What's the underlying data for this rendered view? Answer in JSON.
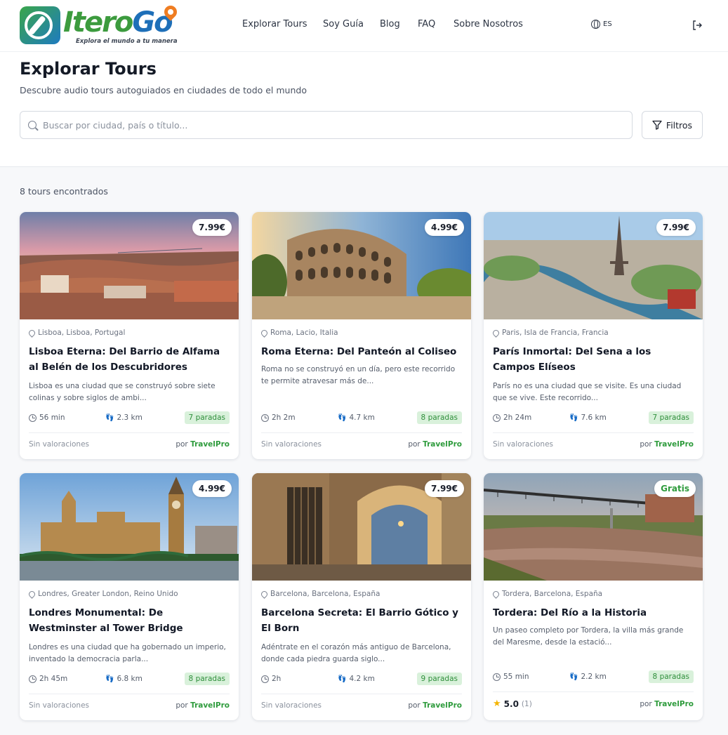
{
  "brand": {
    "name_part1": "Itero",
    "name_part2": "Go",
    "tagline": "Explora el mundo a tu manera",
    "colors": {
      "green": "#3c9b3e",
      "blue": "#1e6fb8",
      "orange": "#ef7d22"
    }
  },
  "nav": {
    "items": [
      {
        "label": "Explorar Tours"
      },
      {
        "label": "Soy Guía"
      },
      {
        "label": "Blog"
      },
      {
        "label": "FAQ"
      },
      {
        "label": "Sobre Nosotros"
      }
    ],
    "language": "ES",
    "icons": {
      "language": "globe-icon",
      "logout": "logout-icon"
    }
  },
  "page": {
    "title": "Explorar Tours",
    "subtitle": "Descubre audio tours autoguiados en ciudades de todo el mundo",
    "search_placeholder": "Buscar por ciudad, país o título...",
    "filters_label": "Filtros",
    "results_count": "8 tours encontrados"
  },
  "tours": [
    {
      "price": "7.99€",
      "location": "Lisboa, Lisboa, Portugal",
      "title": "Lisboa Eterna: Del Barrio de Alfama al Belén de los Descubridores",
      "description": "Lisboa es una ciudad que se construyó sobre siete colinas y sobre siglos de ambi...",
      "duration": "56 min",
      "distance": "2.3 km",
      "stops": "7 paradas",
      "rating_text": "Sin valoraciones",
      "by": "por",
      "author": "TravelPro"
    },
    {
      "price": "4.99€",
      "location": "Roma, Lacio, Italia",
      "title": "Roma Eterna: Del Panteón al Coliseo",
      "description": "Roma no se construyó en un día, pero este recorrido te permite atravesar más de...",
      "duration": "2h 2m",
      "distance": "4.7 km",
      "stops": "8 paradas",
      "rating_text": "Sin valoraciones",
      "by": "por",
      "author": "TravelPro"
    },
    {
      "price": "7.99€",
      "location": "Paris, Isla de Francia, Francia",
      "title": "París Inmortal: Del Sena a los Campos Elíseos",
      "description": "París no es una ciudad que se visite. Es una ciudad que se vive. Este recorrido...",
      "duration": "2h 24m",
      "distance": "7.6 km",
      "stops": "7 paradas",
      "rating_text": "Sin valoraciones",
      "by": "por",
      "author": "TravelPro"
    },
    {
      "price": "4.99€",
      "location": "Londres, Greater London, Reino Unido",
      "title": "Londres Monumental: De Westminster al Tower Bridge",
      "description": "Londres es una ciudad que ha gobernado un imperio, inventado la democracia parla...",
      "duration": "2h 45m",
      "distance": "6.8 km",
      "stops": "8 paradas",
      "rating_text": "Sin valoraciones",
      "by": "por",
      "author": "TravelPro"
    },
    {
      "price": "7.99€",
      "location": "Barcelona, Barcelona, España",
      "title": "Barcelona Secreta: El Barrio Gótico y El Born",
      "description": "Adéntrate en el corazón más antiguo de Barcelona, donde cada piedra guarda siglo...",
      "duration": "2h",
      "distance": "4.2 km",
      "stops": "9 paradas",
      "rating_text": "Sin valoraciones",
      "by": "por",
      "author": "TravelPro"
    },
    {
      "price": "Gratis",
      "location": "Tordera, Barcelona, España",
      "title": "Tordera: Del Río a la Historia",
      "description": "Un paseo completo por Tordera, la villa más grande del Maresme, desde la estació...",
      "duration": "55 min",
      "distance": "2.2 km",
      "stops": "8 paradas",
      "rating_score": "5.0",
      "rating_count": "(1)",
      "by": "por",
      "author": "TravelPro"
    }
  ]
}
